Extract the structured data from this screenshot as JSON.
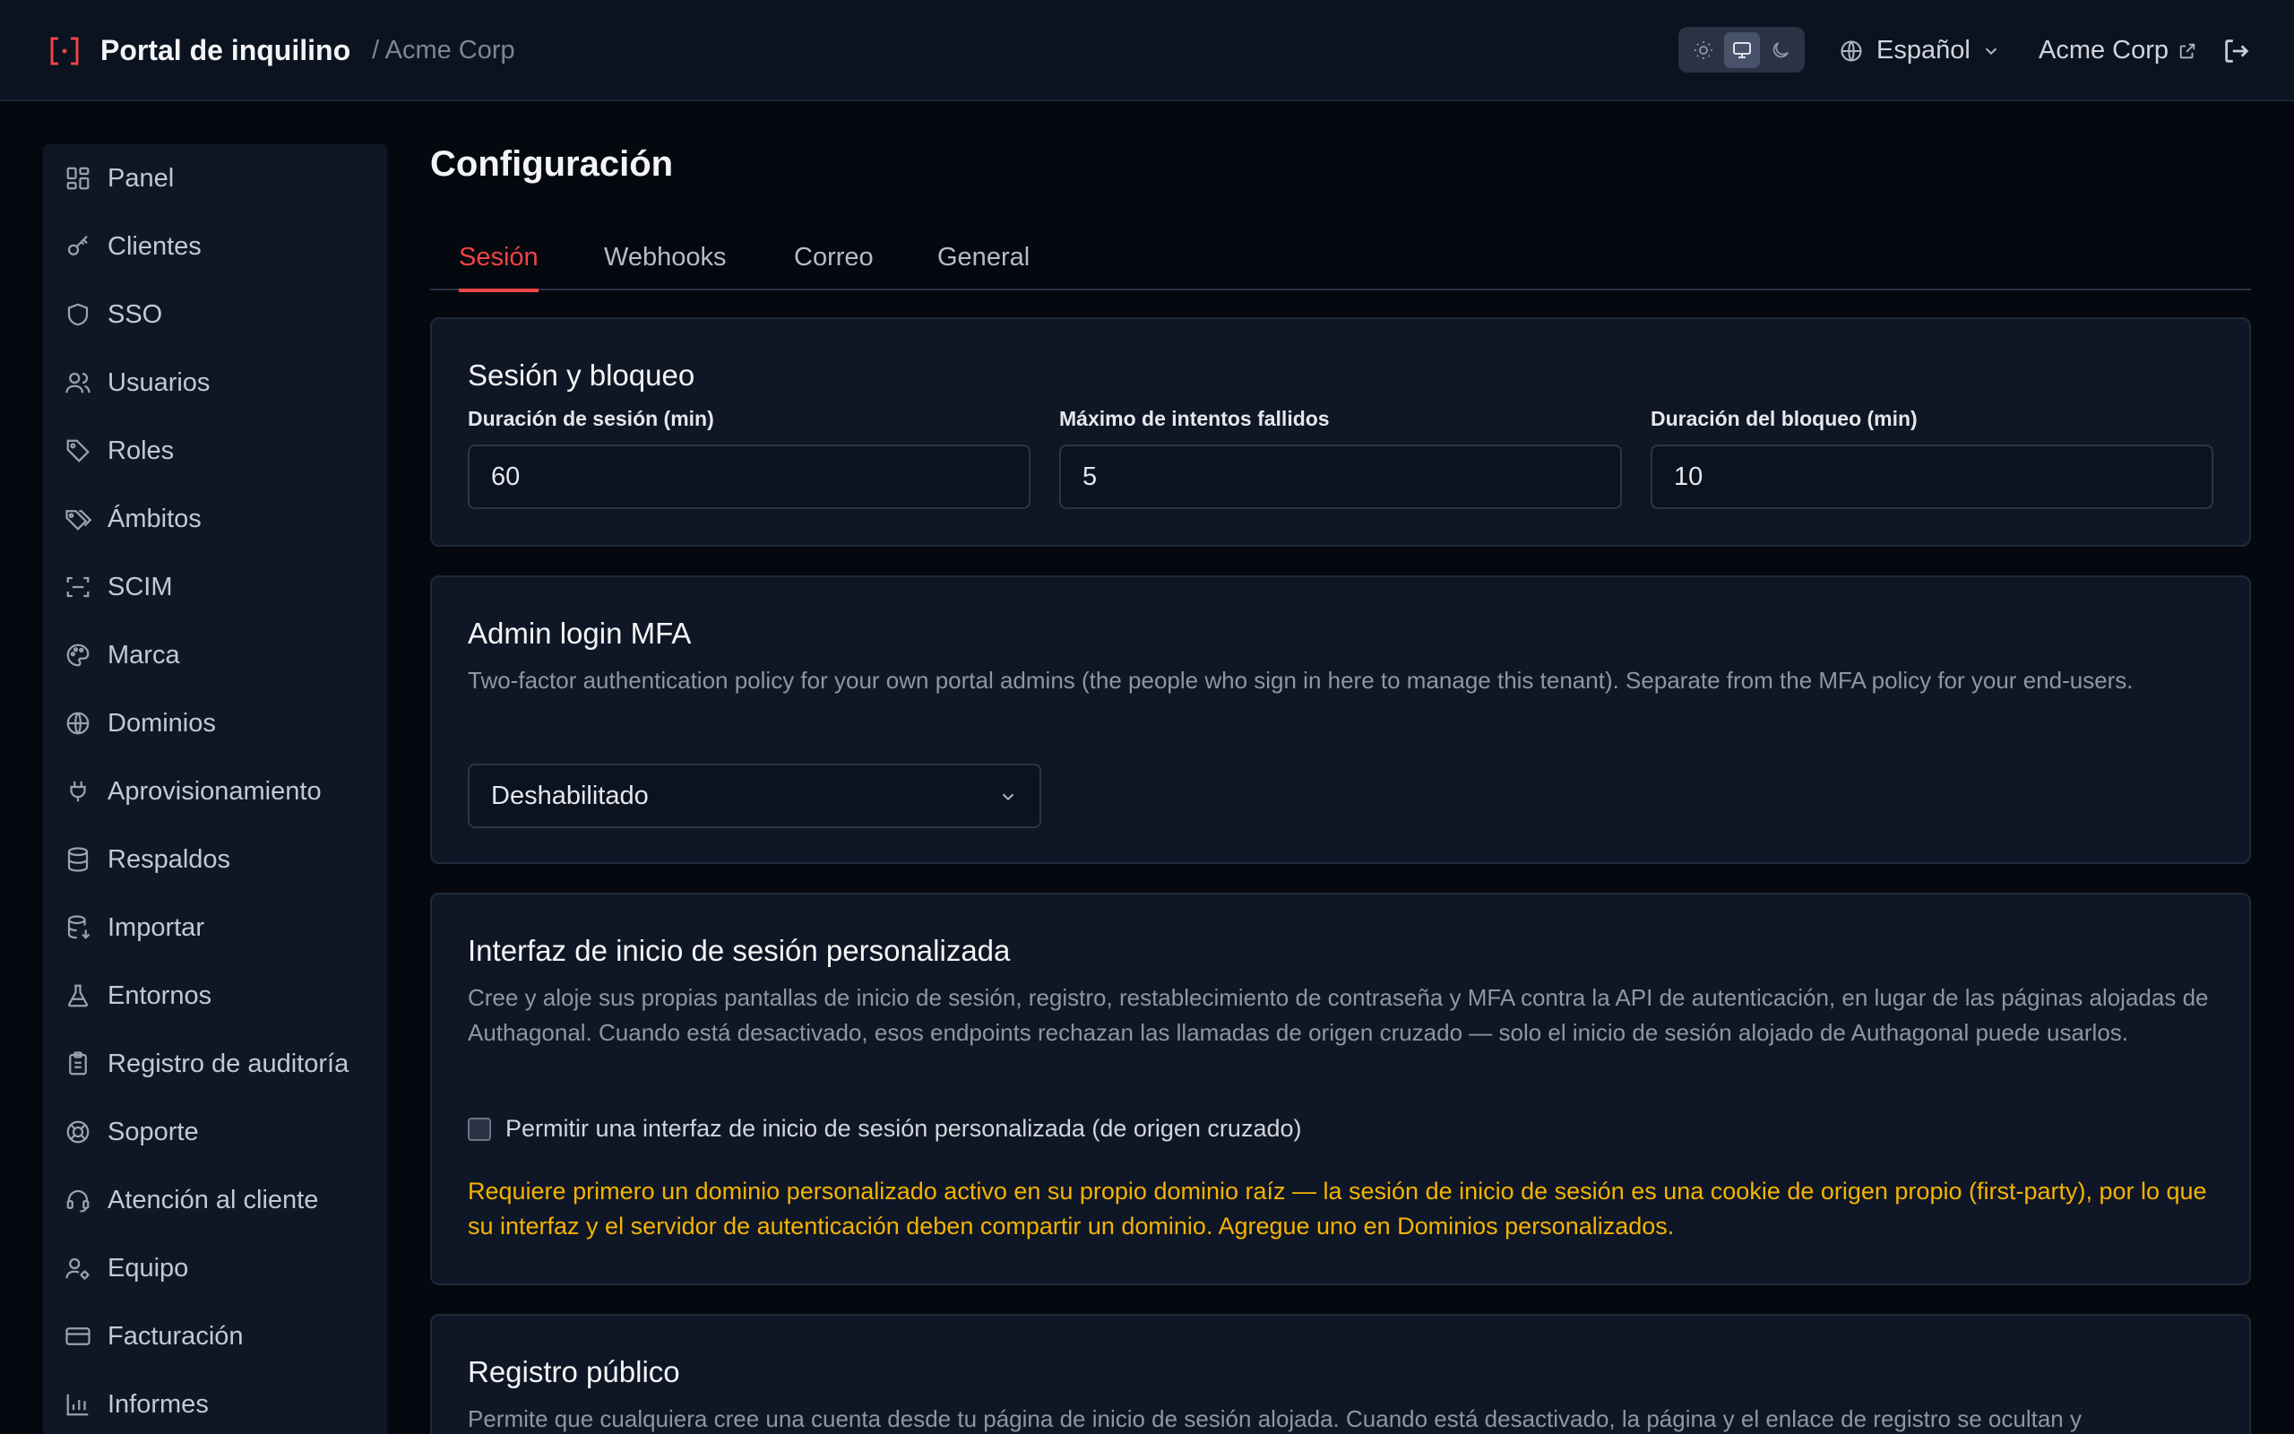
{
  "header": {
    "title": "Portal de inquilino",
    "tenant_crumb": "/ Acme Corp",
    "theme_options": [
      "light-icon",
      "system-icon",
      "dark-icon"
    ],
    "language": "Español",
    "org_link": "Acme Corp"
  },
  "sidebar": {
    "items": [
      {
        "label": "Panel",
        "icon": "dashboard-icon"
      },
      {
        "label": "Clientes",
        "icon": "key-icon"
      },
      {
        "label": "SSO",
        "icon": "shield-icon"
      },
      {
        "label": "Usuarios",
        "icon": "users-icon"
      },
      {
        "label": "Roles",
        "icon": "tag-icon"
      },
      {
        "label": "Ámbitos",
        "icon": "tags-icon"
      },
      {
        "label": "SCIM",
        "icon": "scan-icon"
      },
      {
        "label": "Marca",
        "icon": "palette-icon"
      },
      {
        "label": "Dominios",
        "icon": "globe-icon"
      },
      {
        "label": "Aprovisionamiento",
        "icon": "plug-icon"
      },
      {
        "label": "Respaldos",
        "icon": "database-icon"
      },
      {
        "label": "Importar",
        "icon": "database-import-icon"
      },
      {
        "label": "Entornos",
        "icon": "flask-icon"
      },
      {
        "label": "Registro de auditoría",
        "icon": "clipboard-icon"
      },
      {
        "label": "Soporte",
        "icon": "lifebuoy-icon"
      },
      {
        "label": "Atención al cliente",
        "icon": "headset-icon"
      },
      {
        "label": "Equipo",
        "icon": "user-gear-icon"
      },
      {
        "label": "Facturación",
        "icon": "credit-card-icon"
      },
      {
        "label": "Informes",
        "icon": "bar-chart-icon"
      }
    ]
  },
  "main": {
    "title": "Configuración",
    "tabs": [
      {
        "label": "Sesión",
        "active": true
      },
      {
        "label": "Webhooks",
        "active": false
      },
      {
        "label": "Correo",
        "active": false
      },
      {
        "label": "General",
        "active": false
      }
    ],
    "session_card": {
      "title": "Sesión y bloqueo",
      "fields": [
        {
          "label": "Duración de sesión (min)",
          "value": "60"
        },
        {
          "label": "Máximo de intentos fallidos",
          "value": "5"
        },
        {
          "label": "Duración del bloqueo (min)",
          "value": "10"
        }
      ]
    },
    "mfa_card": {
      "title": "Admin login MFA",
      "description": "Two-factor authentication policy for your own portal admins (the people who sign in here to manage this tenant). Separate from the MFA policy for your end-users.",
      "select_value": "Deshabilitado"
    },
    "custom_login_card": {
      "title": "Interfaz de inicio de sesión personalizada",
      "description": "Cree y aloje sus propias pantallas de inicio de sesión, registro, restablecimiento de contraseña y MFA contra la API de autenticación, en lugar de las páginas alojadas de Authagonal. Cuando está desactivado, esos endpoints rechazan las llamadas de origen cruzado — solo el inicio de sesión alojado de Authagonal puede usarlos.",
      "checkbox_label": "Permitir una interfaz de inicio de sesión personalizada (de origen cruzado)",
      "checkbox_checked": false,
      "warning": "Requiere primero un dominio personalizado activo en su propio dominio raíz — la sesión de inicio de sesión es una cookie de origen propio (first-party), por lo que su interfaz y el servidor de autenticación deben compartir un dominio. Agregue uno en Dominios personalizados."
    },
    "public_registration_card": {
      "title": "Registro público",
      "description": "Permite que cualquiera cree una cuenta desde tu página de inicio de sesión alojada. Cuando está desactivado, la página y el enlace de registro se ocultan y"
    }
  },
  "colors": {
    "accent": "#ef4444",
    "warning": "#f5b301",
    "background": "#05080f",
    "panel": "#0f1726"
  }
}
